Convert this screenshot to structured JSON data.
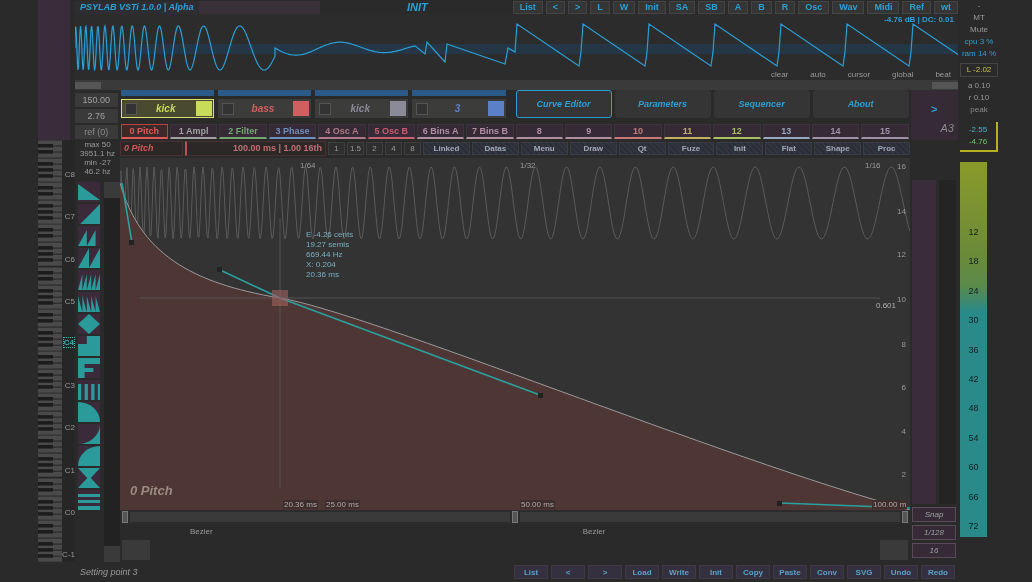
{
  "header": {
    "title": "PSYLAB VSTi 1.0.0 | Alpha",
    "preset": "INIT",
    "buttons": [
      "List",
      "<",
      ">",
      "L",
      "W",
      "Init",
      "SA",
      "SB",
      "A",
      "B",
      "R",
      "Osc",
      "Wav",
      "Midi",
      "Ref",
      "wt"
    ]
  },
  "scope": {
    "readout": "-4.76 dB | DC: 0.01",
    "options": [
      "clear",
      "auto",
      "cursor",
      "global",
      "beat"
    ]
  },
  "side_panel": {
    "dash": "-",
    "mt": "MT",
    "mute": "Mute",
    "cpu": "cpu  3 %",
    "ram": "ram 14 %",
    "left": "L -2.02",
    "attack": "a 0.10",
    "release": "r 0.10",
    "peak": "peak",
    "peak_values": [
      "-2.55",
      "-4.76"
    ]
  },
  "tempo": {
    "bpm": "150.00",
    "value": "2.76",
    "ref": "ref (0)"
  },
  "slots": [
    {
      "name": "kick",
      "selected": true,
      "color": "#c8dc5a"
    },
    {
      "name": "bass",
      "selected": false,
      "color": "#d06060"
    },
    {
      "name": "kick",
      "selected": false,
      "color": "#8a8a98"
    },
    {
      "name": "3",
      "selected": false,
      "color": "#5a80c8"
    }
  ],
  "tabs": [
    {
      "label": "Curve Editor",
      "selected": true
    },
    {
      "label": "Parameters",
      "selected": false
    },
    {
      "label": "Sequencer",
      "selected": false
    },
    {
      "label": "About",
      "selected": false
    }
  ],
  "next": ">",
  "note": "A3",
  "curve_tabs": [
    {
      "label": "0 Pitch",
      "selected": true,
      "color": "#e05a5a"
    },
    {
      "label": "1 Ampl",
      "selected": false,
      "color": "#a0a0a0"
    },
    {
      "label": "2 Filter",
      "selected": false,
      "color": "#70a870"
    },
    {
      "label": "3 Phase",
      "selected": false,
      "color": "#6a90c0"
    },
    {
      "label": "4 Osc A",
      "selected": false,
      "color": "#b07888"
    },
    {
      "label": "5 Osc B",
      "selected": false,
      "color": "#c86070"
    },
    {
      "label": "6 Bins A",
      "selected": false,
      "color": "#b090a0"
    },
    {
      "label": "7 Bins B",
      "selected": false,
      "color": "#b090a0"
    },
    {
      "label": "8",
      "selected": false,
      "color": "#b090a0"
    },
    {
      "label": "9",
      "selected": false,
      "color": "#b090a0"
    },
    {
      "label": "10",
      "selected": false,
      "color": "#c87878"
    },
    {
      "label": "11",
      "selected": false,
      "color": "#c0b060"
    },
    {
      "label": "12",
      "selected": false,
      "color": "#a8c060"
    },
    {
      "label": "13",
      "selected": false,
      "color": "#98a8c0"
    },
    {
      "label": "14",
      "selected": false,
      "color": "#a090a8"
    },
    {
      "label": "15",
      "selected": false,
      "color": "#a090a8"
    }
  ],
  "toolbar": {
    "curve": "0 Pitch",
    "length": "100.00 ms | 1.00 16th",
    "divisions": [
      "1",
      "1.5",
      "2",
      "4",
      "8"
    ],
    "buttons": [
      "Linked",
      "Datas",
      "Menu",
      "Draw",
      "Qt",
      "Fuze",
      "Init",
      "Flat",
      "Shape",
      "Proc"
    ]
  },
  "range": [
    "max 50",
    "3951.1 hz",
    "min -27",
    "46.2 hz"
  ],
  "octaves": [
    {
      "label": "C8",
      "selected": false
    },
    {
      "label": "C7",
      "selected": false
    },
    {
      "label": "C6",
      "selected": false
    },
    {
      "label": "C5",
      "selected": false
    },
    {
      "label": "C4",
      "selected": true
    },
    {
      "label": "C3",
      "selected": false
    },
    {
      "label": "C2",
      "selected": false
    },
    {
      "label": "C1",
      "selected": false
    },
    {
      "label": "C0",
      "selected": false
    },
    {
      "label": "C-1",
      "selected": false
    }
  ],
  "editor": {
    "title": "0 Pitch",
    "top_ticks": [
      "1/64",
      "1/32",
      "1/16"
    ],
    "y_ticks": [
      "16",
      "14",
      "12",
      "10",
      "8",
      "6",
      "4",
      "2"
    ],
    "cursor_value": "0.601",
    "readout": [
      "E -4.26 cents",
      "19.27 semis",
      "669.44 Hz",
      "X: 0.204",
      "20.36 ms"
    ],
    "time_labels": [
      "20.36 ms",
      "25.00 ms",
      "50.00 ms",
      "100.00 m"
    ],
    "segment_modes": [
      "Bezier",
      "Bezier"
    ]
  },
  "snap": {
    "label": "Snap",
    "grid": "1/128",
    "count": "16"
  },
  "meter": {
    "ticks": [
      "12",
      "18",
      "24",
      "30",
      "36",
      "42",
      "48",
      "54",
      "60",
      "66",
      "72"
    ]
  },
  "status": {
    "message": "Setting point 3",
    "buttons": [
      "List",
      "<",
      ">",
      "Load",
      "Write",
      "Init",
      "Copy",
      "Paste",
      "Conv",
      "SVG",
      "Undo",
      "Redo"
    ]
  }
}
